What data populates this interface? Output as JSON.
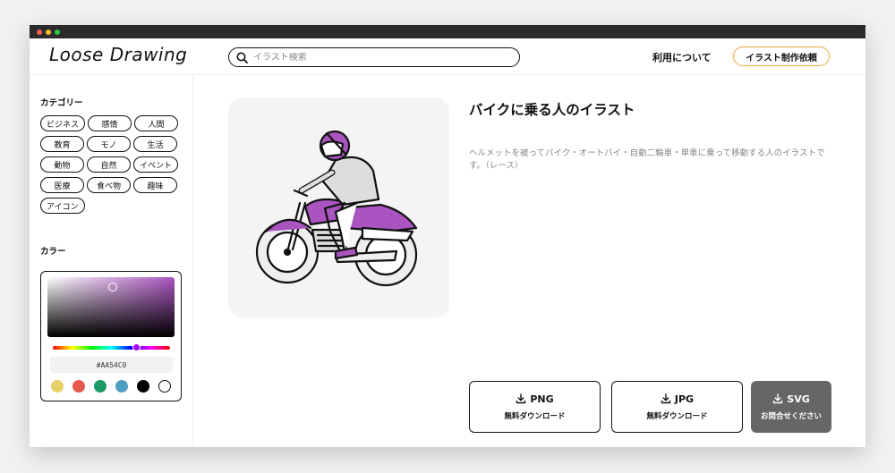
{
  "header": {
    "logo": "Loose Drawing",
    "search_placeholder": "イラスト検索",
    "about": "利用について",
    "request": "イラスト制作依頼"
  },
  "sidebar": {
    "category_title": "カテゴリー",
    "categories": [
      "ビジネス",
      "感情",
      "人間",
      "教育",
      "モノ",
      "生活",
      "動物",
      "自然",
      "イベント",
      "医療",
      "食べ物",
      "趣味",
      "アイコン"
    ],
    "color_title": "カラー",
    "hex_value": "#AA54C0",
    "swatches": [
      "#e8cf6a",
      "#e8584f",
      "#1c9a66",
      "#4f9ec2",
      "#000000",
      "#ffffff"
    ]
  },
  "illustration": {
    "title": "バイクに乗る人のイラスト",
    "description": "ヘルメットを被ってバイク・オートバイ・自動二輪車・単車に乗って移動する人のイラストです。（レース）",
    "accent_color": "#aa54c0"
  },
  "downloads": {
    "png": {
      "format": "PNG",
      "label": "無料ダウンロード"
    },
    "jpg": {
      "format": "JPG",
      "label": "無料ダウンロード"
    },
    "svg": {
      "format": "SVG",
      "label": "お問合せください"
    }
  }
}
